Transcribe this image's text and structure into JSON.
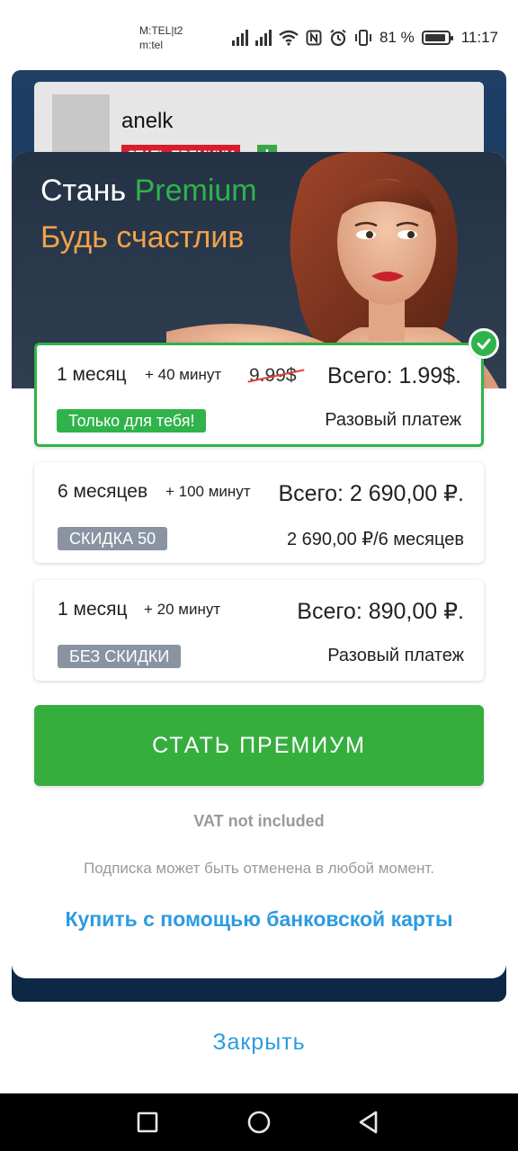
{
  "status_bar": {
    "carrier_line1": "M:TEL|t2",
    "carrier_line2": "m:tel",
    "battery_percent": "81 %",
    "time": "11:17"
  },
  "background": {
    "username": "anelk",
    "premium_badge": "СТАТЬ ПРЕМИУМ",
    "plus": "+"
  },
  "hero": {
    "title_prefix": "Стань ",
    "title_accent": "Premium",
    "subtitle": "Будь счастлив"
  },
  "plans": [
    {
      "period": "1 месяц",
      "extra": "+ 40 минут",
      "old_price": "9.99$",
      "total": "Всего: 1.99$.",
      "tag": "Только для тебя!",
      "note": "Разовый платеж",
      "selected": true
    },
    {
      "period": "6 месяцев",
      "extra": "+ 100 минут",
      "total": "Всего: 2 690,00 ₽.",
      "tag": "СКИДКА 50",
      "note": "2 690,00 ₽/6 месяцев",
      "selected": false
    },
    {
      "period": "1 месяц",
      "extra": "+ 20 минут",
      "total": "Всего: 890,00 ₽.",
      "tag": "БЕЗ СКИДКИ",
      "note": "Разовый платеж",
      "selected": false
    }
  ],
  "cta_label": "СТАТЬ ПРЕМИУМ",
  "vat_note": "VAT not included",
  "cancel_note": "Подписка может быть отменена в любой момент.",
  "card_link": "Купить с помощью банковской карты",
  "close_label": "Закрыть",
  "colors": {
    "accent_green": "#36ae3e",
    "accent_orange": "#f0a24a",
    "link_blue": "#2c9be0",
    "hero_bg": "#2a3749"
  },
  "icons": [
    "signal-icon",
    "wifi-icon",
    "nfc-icon",
    "alarm-icon",
    "vibrate-icon",
    "battery-icon",
    "check-icon",
    "recent-apps-icon",
    "home-icon",
    "back-icon"
  ]
}
